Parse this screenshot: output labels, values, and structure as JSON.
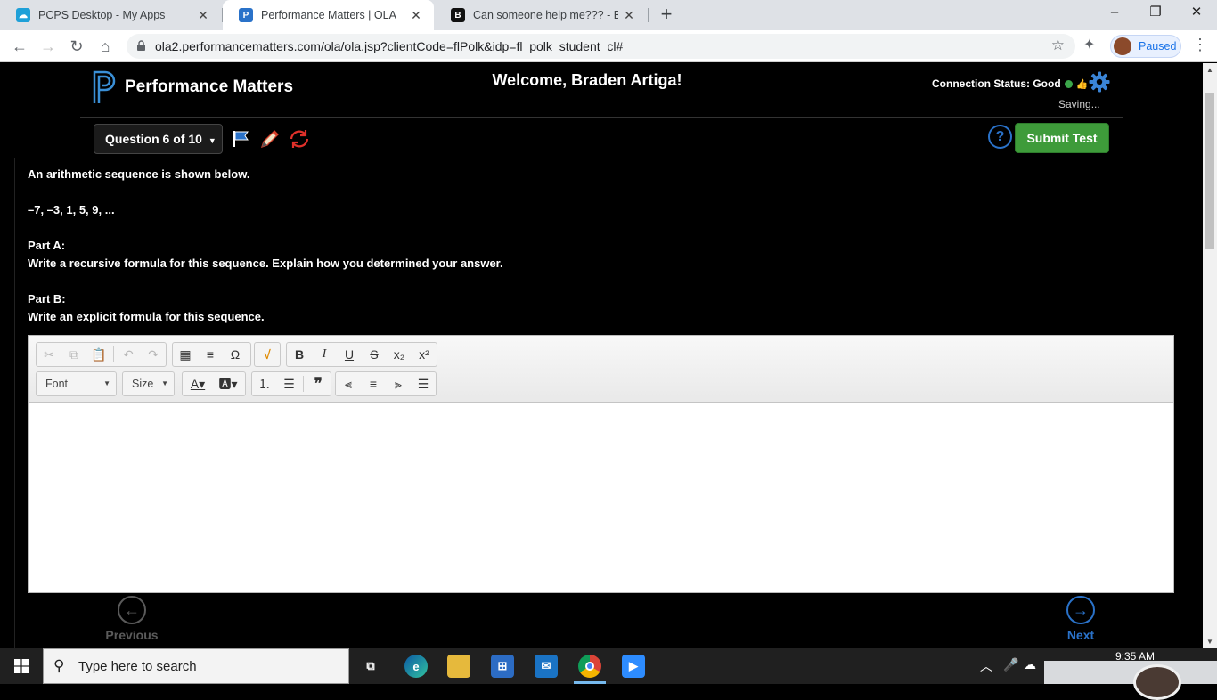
{
  "browser": {
    "tabs": [
      {
        "title": "PCPS Desktop - My Apps",
        "active": false
      },
      {
        "title": "Performance Matters | OLA",
        "active": true
      },
      {
        "title": "Can someone help me??? - Brainly",
        "active": false
      }
    ],
    "url": "ola2.performancematters.com/ola/ola.jsp?clientCode=flPolk&idp=fl_polk_student_cl#",
    "profile_label": "Paused"
  },
  "header": {
    "logo_text": "Performance Matters",
    "welcome": "Welcome, Braden Artiga!",
    "connection_status": "Connection Status: Good",
    "saving": "Saving...",
    "question_selector": "Question 6 of 10",
    "help_label": "?",
    "submit_label": "Submit Test"
  },
  "question": {
    "intro": "An arithmetic sequence is shown below.",
    "sequence": "–7, –3, 1, 5, 9, ...",
    "part_a_label": "Part A:",
    "part_a_text": "Write a recursive formula for this sequence.  Explain how you determined your answer.",
    "part_b_label": "Part B:",
    "part_b_text": "Write an explicit formula for this sequence."
  },
  "editor": {
    "font_label": "Font",
    "size_label": "Size",
    "content": ""
  },
  "footer": {
    "previous_label": "Previous",
    "next_label": "Next"
  },
  "taskbar": {
    "search_placeholder": "Type here to search",
    "time": "9:35 AM"
  },
  "colors": {
    "page_bg": "#000000",
    "submit_green": "#3e9b3a",
    "accent_blue": "#2a72c9",
    "status_green": "#3ba64a"
  }
}
